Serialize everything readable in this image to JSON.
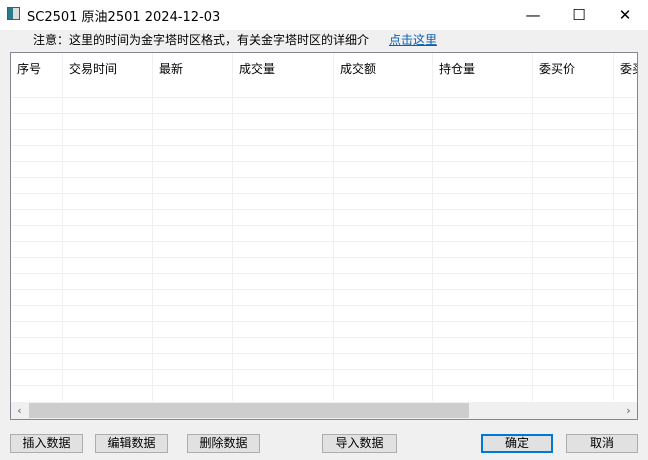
{
  "window": {
    "title": "SC2501 原油2501 2024-12-03",
    "minimize": "—",
    "maximize": "☐",
    "close": "✕"
  },
  "notice": {
    "text": "注意：这里的时间为金字塔时区格式，有关金字塔时区的详细介",
    "link": "点击这里"
  },
  "table": {
    "columns": [
      "序号",
      "交易时间",
      "最新",
      "成交量",
      "成交额",
      "持仓量",
      "委买价",
      "委买量"
    ],
    "rows": []
  },
  "scrollbar": {
    "left": "‹",
    "right": "›"
  },
  "buttons": {
    "insert": "插入数据",
    "edit": "编辑数据",
    "delete": "删除数据",
    "import": "导入数据",
    "ok": "确定",
    "cancel": "取消"
  }
}
